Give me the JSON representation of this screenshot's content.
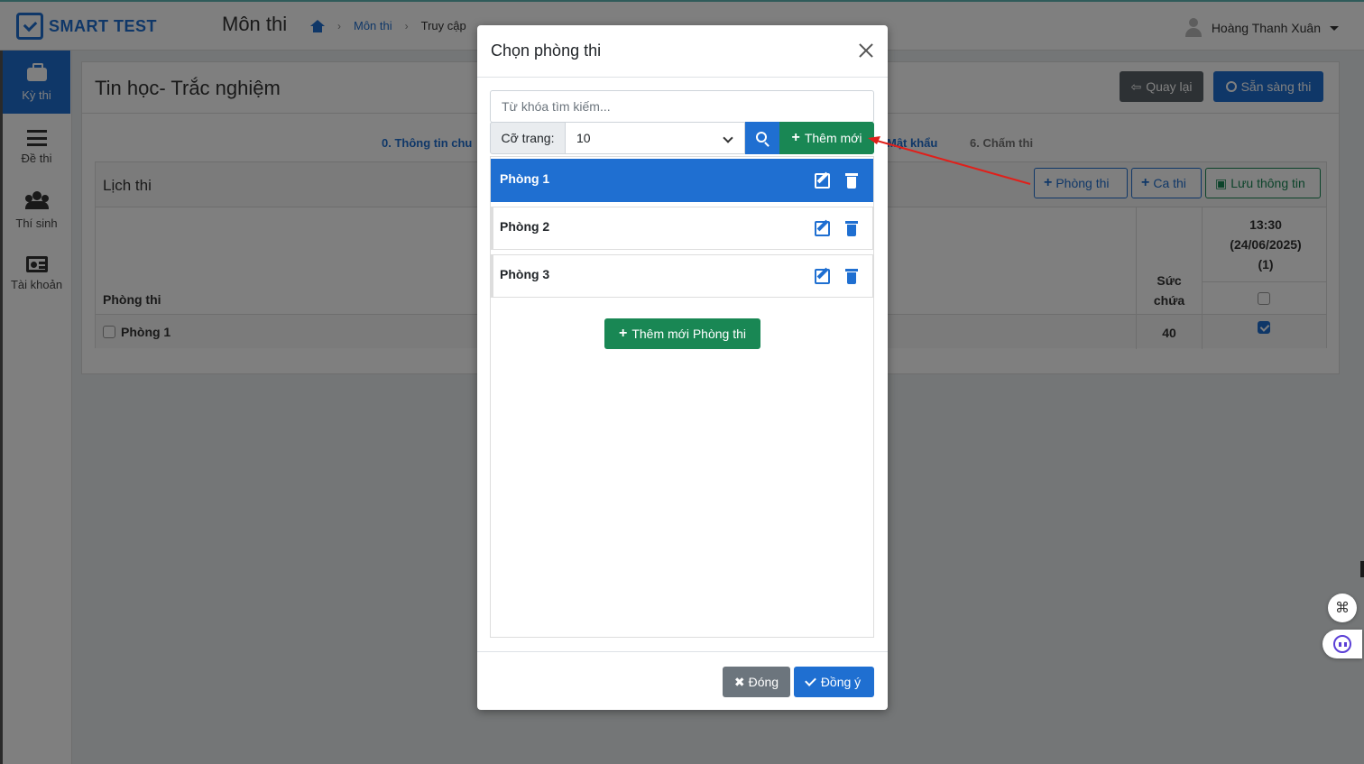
{
  "app": {
    "logo_text": "SMART TEST",
    "page_heading": "Môn thi",
    "breadcrumb": [
      "Môn thi",
      "Truy cập"
    ],
    "user_name": "Hoàng Thanh Xuân"
  },
  "sidebar": {
    "items": [
      {
        "label": "Kỳ thi",
        "icon": "briefcase-icon",
        "active": true
      },
      {
        "label": "Đề thi",
        "icon": "list-icon",
        "active": false
      },
      {
        "label": "Thí sinh",
        "icon": "users-icon",
        "active": false
      },
      {
        "label": "Tài khoản",
        "icon": "id-card-icon",
        "active": false
      }
    ]
  },
  "main": {
    "exam_title": "Tin học- Trắc nghiệm",
    "back_label": "Quay lại",
    "ready_label": "Sẵn sàng thi",
    "steps": [
      "0. Thông tin chu",
      "Mật khẩu",
      "6. Chấm thi"
    ],
    "schedule": {
      "title": "Lịch thi",
      "add_room_label": "Phòng thi",
      "add_shift_label": "Ca thi",
      "save_label": "Lưu thông tin",
      "col_room": "Phòng thi",
      "col_capacity": "Sức chứa",
      "col_time": "13:30",
      "col_date": "(24/06/2025)",
      "col_count": "(1)",
      "rows": [
        {
          "room": "Phòng 1",
          "capacity": "40",
          "checked": true
        }
      ]
    }
  },
  "modal": {
    "title": "Chọn phòng thi",
    "search_placeholder": "Từ khóa tìm kiếm...",
    "page_size_label": "Cỡ trang:",
    "page_size_value": "10",
    "add_new_label": "Thêm mới",
    "rooms": [
      {
        "name": "Phòng 1",
        "selected": true
      },
      {
        "name": "Phòng 2",
        "selected": false
      },
      {
        "name": "Phòng 3",
        "selected": false
      }
    ],
    "add_room_label": "Thêm mới Phòng thi",
    "close_label": "Đóng",
    "ok_label": "Đồng ý"
  },
  "colors": {
    "primary": "#1f6fd1",
    "success": "#198754",
    "secondary": "#6c757d",
    "annotation_arrow": "#e0201b"
  }
}
